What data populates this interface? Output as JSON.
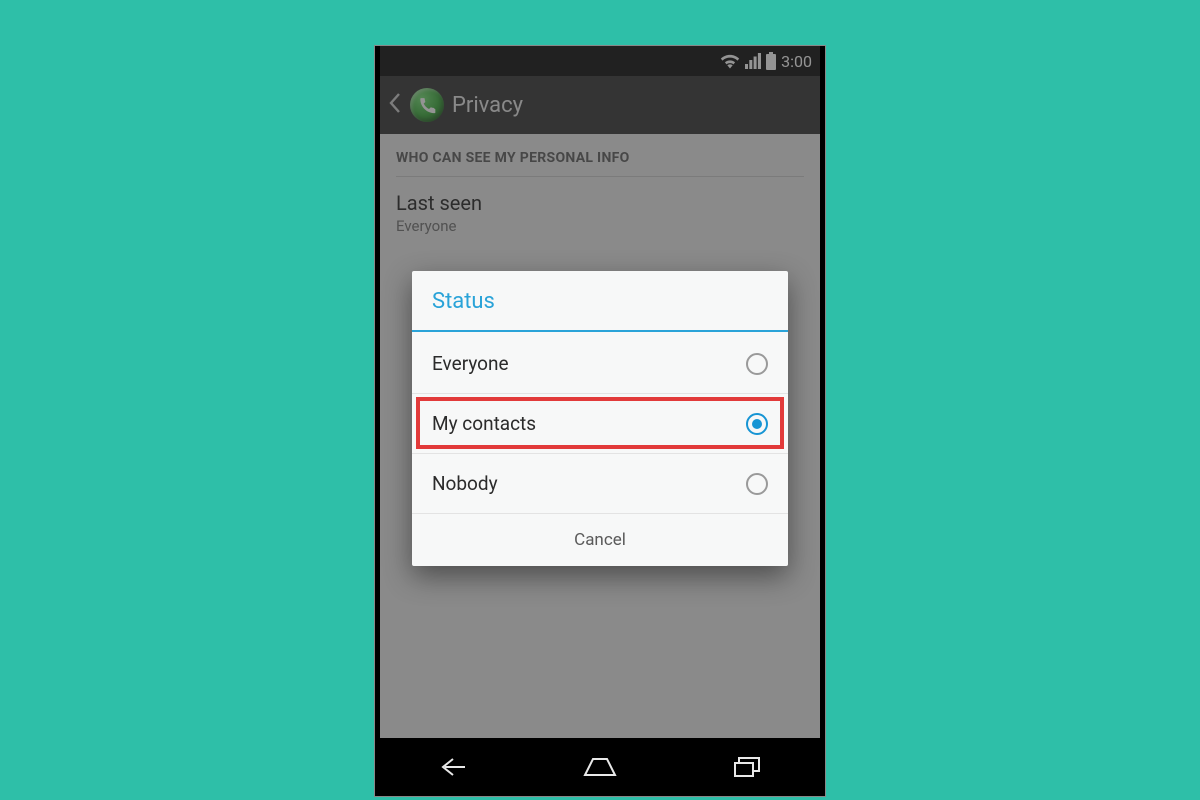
{
  "statusbar": {
    "time": "3:00"
  },
  "actionbar": {
    "title": "Privacy"
  },
  "content": {
    "section_header": "WHO CAN SEE MY PERSONAL INFO",
    "last_seen": {
      "title": "Last seen",
      "value": "Everyone"
    }
  },
  "dialog": {
    "title": "Status",
    "options": {
      "everyone": "Everyone",
      "my_contacts": "My contacts",
      "nobody": "Nobody"
    },
    "selected": "my_contacts",
    "cancel": "Cancel"
  }
}
